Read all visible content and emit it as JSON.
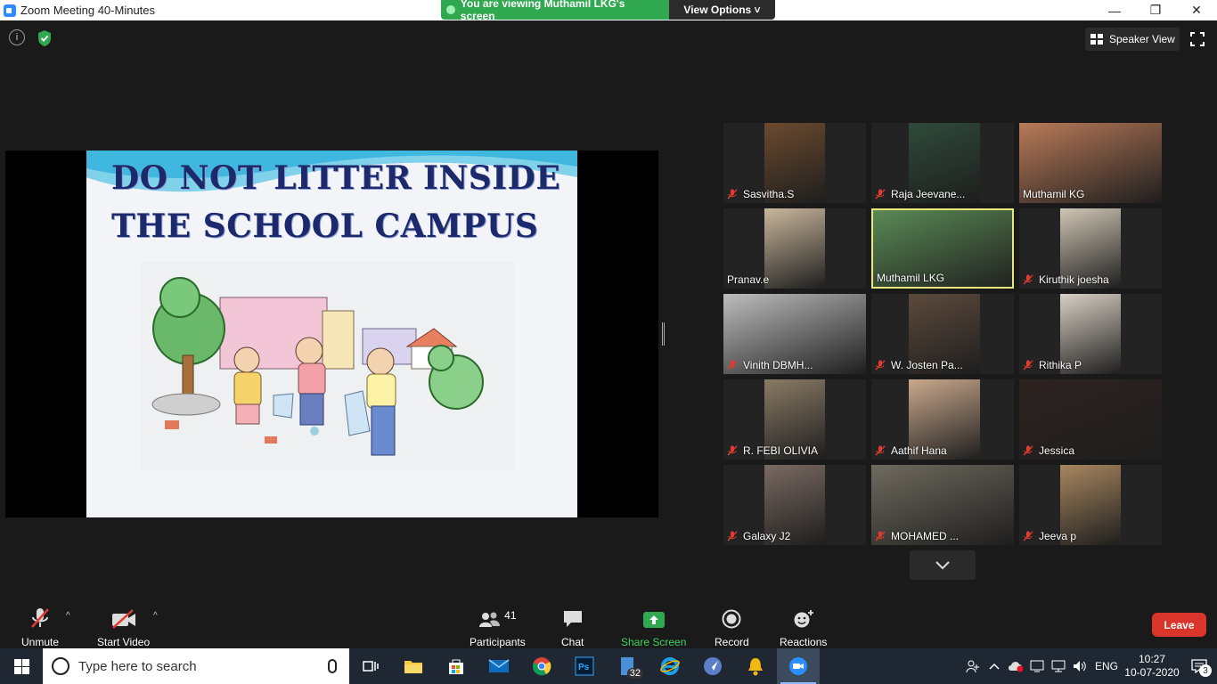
{
  "window": {
    "title": "Zoom Meeting 40-Minutes",
    "minimize_label": "—",
    "maximize_label": "❐",
    "close_label": "✕"
  },
  "share_banner": {
    "viewing_text": "You are viewing Muthamil LKG's screen",
    "view_options_label": "View Options ˅"
  },
  "top": {
    "info_glyph": "i",
    "speaker_view_label": "Speaker View"
  },
  "slide": {
    "title_line1": "DO NOT LITTER INSIDE",
    "title_line2": "THE SCHOOL CAMPUS"
  },
  "participants_tiles": [
    {
      "name": "Sasvitha.S",
      "muted": true,
      "tone": "#6b4a2e"
    },
    {
      "name": "Raja Jeevane...",
      "muted": true,
      "tone": "#2f4a3a"
    },
    {
      "name": "Muthamil KG",
      "muted": false,
      "tone": "#b97a58"
    },
    {
      "name": "Pranav.e",
      "muted": false,
      "tone": "#c9b79d"
    },
    {
      "name": "Muthamil LKG",
      "muted": false,
      "tone": "#5a8a55"
    },
    {
      "name": "Kiruthik joesha",
      "muted": true,
      "tone": "#cfc6b5"
    },
    {
      "name": "Vinith DBMH...",
      "muted": true,
      "tone": "#bdbdbd"
    },
    {
      "name": "W. Josten Pa...",
      "muted": true,
      "tone": "#5c4a3d"
    },
    {
      "name": "Rithika P",
      "muted": true,
      "tone": "#d8d0c4"
    },
    {
      "name": "R. FEBI  OLIVIA",
      "muted": true,
      "tone": "#8a7b66"
    },
    {
      "name": "Aathif  Hana",
      "muted": true,
      "tone": "#caa98d"
    },
    {
      "name": "Jessica",
      "muted": true,
      "tone": "#2d2320"
    },
    {
      "name": "Galaxy J2",
      "muted": true,
      "tone": "#7a6a62"
    },
    {
      "name": "MOHAMED ...",
      "muted": true,
      "tone": "#6e6a5e"
    },
    {
      "name": "Jeeva p",
      "muted": true,
      "tone": "#a8875f"
    }
  ],
  "toolbar": {
    "unmute_label": "Unmute",
    "start_video_label": "Start Video",
    "participants_label": "Participants",
    "participants_count": "41",
    "chat_label": "Chat",
    "share_screen_label": "Share Screen",
    "record_label": "Record",
    "reactions_label": "Reactions",
    "leave_label": "Leave",
    "caret": "^"
  },
  "taskbar": {
    "search_placeholder": "Type here to search",
    "calc_badge": "32",
    "language": "ENG",
    "time": "10:27",
    "date": "10-07-2020",
    "notifications_count": "3"
  },
  "colors": {
    "share_green": "#2fa84f",
    "leave_red": "#d9352a",
    "zoom_blue": "#2d8cff",
    "active_speaker_border": "#e8e87a"
  }
}
